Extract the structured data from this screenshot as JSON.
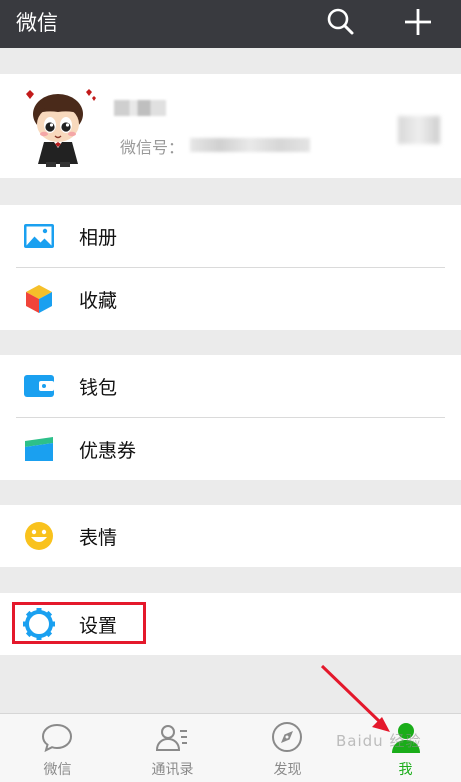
{
  "header": {
    "title": "微信",
    "search_icon": "search-icon",
    "add_icon": "plus-icon"
  },
  "profile": {
    "wxid_label": "微信号："
  },
  "groups": {
    "album": "相册",
    "favorites": "收藏",
    "wallet": "钱包",
    "coupons": "优惠券",
    "stickers": "表情",
    "settings": "设置"
  },
  "tabbar": {
    "chats": "微信",
    "contacts": "通讯录",
    "discover": "发现",
    "me": "我"
  },
  "watermark": "Baidu 经验",
  "colors": {
    "topbar": "#393a3f",
    "accent_green": "#1aad19",
    "highlight_red": "#e4182b",
    "icon_blue": "#1aa0f0"
  }
}
